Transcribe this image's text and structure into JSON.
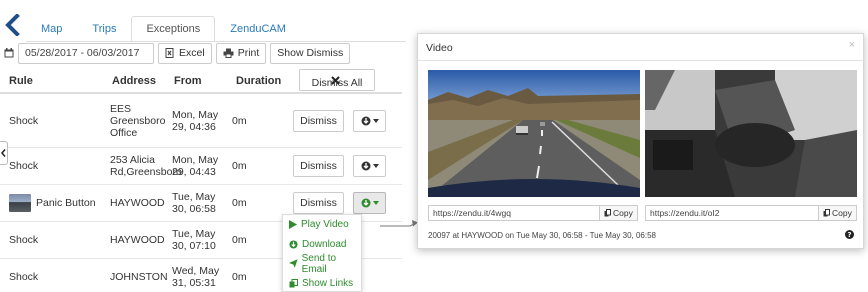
{
  "tabs": [
    {
      "label": "Map",
      "active": false
    },
    {
      "label": "Trips",
      "active": false
    },
    {
      "label": "Exceptions",
      "active": true
    },
    {
      "label": "ZenduCAM",
      "active": false
    }
  ],
  "toolbar": {
    "date_range": "05/28/2017 - 06/03/2017",
    "excel_label": "Excel",
    "print_label": "Print",
    "show_dismiss_label": "Show Dismiss"
  },
  "table": {
    "headers": {
      "rule": "Rule",
      "address": "Address",
      "from": "From",
      "duration": "Duration"
    },
    "dismiss_all_label": "Dismiss All",
    "rows": [
      {
        "rule": "Shock",
        "address": "EES Greensboro Office",
        "from": "Mon, May 29, 04:36",
        "duration": "0m",
        "dismiss": "Dismiss"
      },
      {
        "rule": "Shock",
        "address": "253 Alicia Rd,Greensboro",
        "from": "Mon, May 29, 04:43",
        "duration": "0m",
        "dismiss": "Dismiss"
      },
      {
        "rule": "Panic Button",
        "address": "HAYWOOD",
        "from": "Tue, May 30, 06:58",
        "duration": "0m",
        "dismiss": "Dismiss"
      },
      {
        "rule": "Shock",
        "address": "HAYWOOD",
        "from": "Tue, May 30, 07:10",
        "duration": "0m",
        "dismiss": "Dismiss"
      },
      {
        "rule": "Shock",
        "address": "JOHNSTON",
        "from": "Wed, May 31, 05:31",
        "duration": "0m",
        "dismiss": "Dismiss"
      }
    ]
  },
  "dropdown": {
    "items": [
      "Play Video",
      "Download",
      "Send to Email",
      "Show Links"
    ]
  },
  "video_modal": {
    "title": "Video",
    "close_glyph": "×",
    "links": [
      {
        "url": "https://zendu.it/4wgq",
        "copy_label": "Copy"
      },
      {
        "url": "https://zendu.it/oI2",
        "copy_label": "Copy"
      }
    ],
    "footer": "20097 at HAYWOOD on Tue May 30, 06:58 - Tue May 30, 06:58",
    "help_glyph": "?"
  },
  "colors": {
    "link_blue": "#2a7ab8",
    "dropdown_green": "#2e8b2e",
    "back_chevron": "#1f4e89"
  },
  "icons": [
    "back-chevron-icon",
    "calendar-icon",
    "excel-icon",
    "print-icon",
    "close-x-icon",
    "play-icon",
    "download-icon",
    "send-icon",
    "links-icon",
    "copy-icon",
    "help-icon"
  ]
}
